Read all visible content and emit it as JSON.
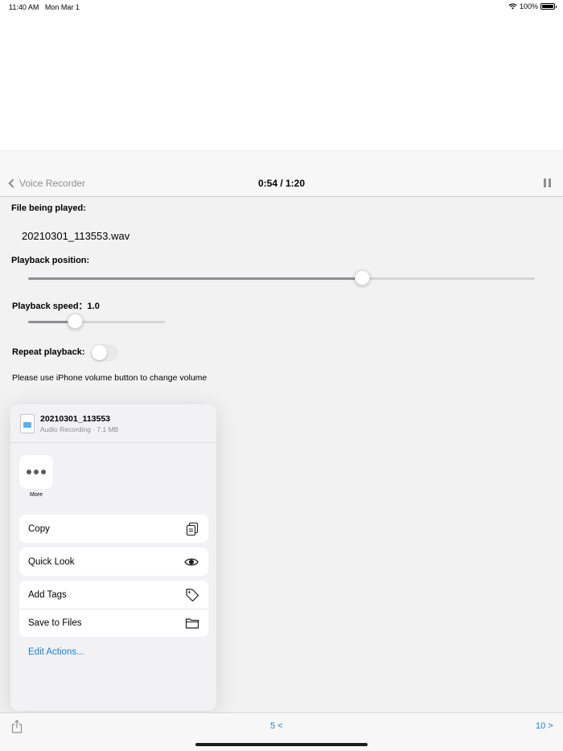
{
  "status_bar": {
    "time": "11:40 AM",
    "date": "Mon Mar 1",
    "battery": "100%"
  },
  "nav": {
    "back_label": "Voice Recorder",
    "title": "0:54 / 1:20"
  },
  "player": {
    "file_label": "File being played:",
    "file_name": "20210301_113553.wav",
    "position_label": "Playback position:",
    "position_fraction": 0.66,
    "speed_label": "Playback speed：1.0",
    "speed_fraction": 0.35,
    "repeat_label": "Repeat playback:",
    "repeat_on": false,
    "volume_note": "Please use iPhone volume button to change volume"
  },
  "share_sheet": {
    "file_title": "20210301_113553",
    "file_meta": "Audio Recording · 7.1 MB",
    "more_label": "More",
    "actions": [
      {
        "label": "Copy",
        "icon": "copy-icon"
      },
      {
        "label": "Quick Look",
        "icon": "eye-icon"
      },
      {
        "label": "Add Tags",
        "icon": "tag-icon"
      },
      {
        "label": "Save to Files",
        "icon": "folder-icon"
      }
    ],
    "edit_actions": "Edit Actions..."
  },
  "toolbar": {
    "back_5": "5 <",
    "forward_10": "10 >"
  },
  "colors": {
    "accent": "#1a7fd1",
    "secondary_text": "#8e8e93"
  }
}
